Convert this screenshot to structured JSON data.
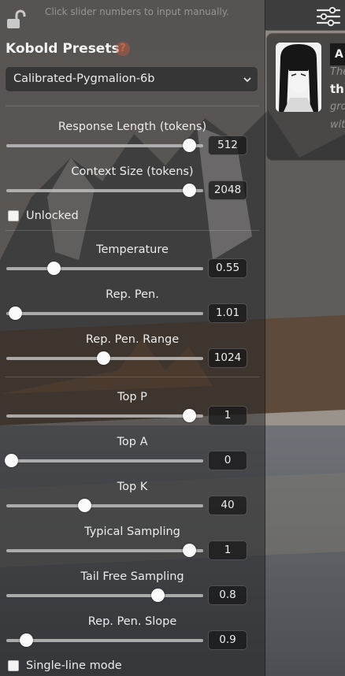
{
  "hint": "Click slider numbers to input manually.",
  "presets": {
    "title": "Kobold Presets",
    "help_icon": "?",
    "selected": "Calibrated-Pygmalion-6b"
  },
  "settings": [
    {
      "label": "Response Length (tokens)",
      "value": "512",
      "fraction": 0.97
    },
    {
      "label": "Context Size (tokens)",
      "value": "2048",
      "fraction": 0.97
    },
    {
      "label": "Temperature",
      "value": "0.55",
      "fraction": 0.23
    },
    {
      "label": "Rep. Pen.",
      "value": "1.01",
      "fraction": 0.02
    },
    {
      "label": "Rep. Pen. Range",
      "value": "1024",
      "fraction": 0.5
    },
    {
      "label": "Top P",
      "value": "1",
      "fraction": 0.97
    },
    {
      "label": "Top A",
      "value": "0",
      "fraction": 0.0
    },
    {
      "label": "Top K",
      "value": "40",
      "fraction": 0.4
    },
    {
      "label": "Typical Sampling",
      "value": "1",
      "fraction": 0.97
    },
    {
      "label": "Tail Free Sampling",
      "value": "0.8",
      "fraction": 0.8
    },
    {
      "label": "Rep. Pen. Slope",
      "value": "0.9",
      "fraction": 0.08
    }
  ],
  "unlocked_label": "Unlocked",
  "single_line_label": "Single-line mode",
  "card": {
    "badge": "A",
    "line_bold": "thi",
    "line_italic_1": "The",
    "line_italic_2": "gro",
    "line_italic_3": "wit"
  },
  "icons": {
    "lock": "unlocked-padlock-icon",
    "settings": "sliders-settings-icon",
    "chevron": "chevron-down-icon"
  },
  "colors": {
    "help_accent": "#c46a50",
    "thumb": "#fafafa",
    "track": "#bebebe"
  }
}
